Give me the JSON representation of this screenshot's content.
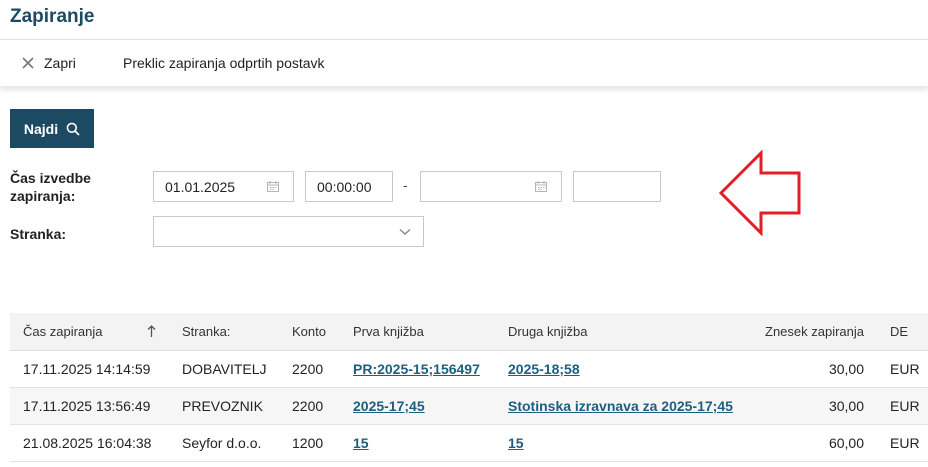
{
  "page": {
    "title": "Zapiranje"
  },
  "toolbar": {
    "close_label": "Zapri",
    "undo_label": "Preklic zapiranja odprtih postavk"
  },
  "search": {
    "button_label": "Najdi"
  },
  "filters": {
    "time_label_line1": "Čas izvedbe",
    "time_label_line2": "zapiranja:",
    "date_from": "01.01.2025",
    "time_from": "00:00:00",
    "date_to": "",
    "time_to": "",
    "separator": "-",
    "partner_label": "Stranka:",
    "partner_value": ""
  },
  "colors": {
    "brand": "#1c4a63",
    "link": "#1c5f7e",
    "arrow": "#e01f26"
  },
  "table": {
    "headers": [
      "Čas zapiranja",
      "Stranka:",
      "Konto",
      "Prva knjižba",
      "Druga knjižba",
      "Znesek zapiranja",
      "DE"
    ],
    "rows": [
      [
        "17.11.2025 14:14:59",
        "DOBAVITELJ",
        "2200",
        "PR:2025-15;156497",
        "2025-18;58",
        "30,00",
        "EUR"
      ],
      [
        "17.11.2025 13:56:49",
        "PREVOZNIK",
        "2200",
        "2025-17;45",
        "Stotinska izravnava za 2025-17;45",
        "30,00",
        "EUR"
      ],
      [
        "21.08.2025 16:04:38",
        "Seyfor d.o.o.",
        "1200",
        "15",
        "15",
        "60,00",
        "EUR"
      ]
    ]
  }
}
